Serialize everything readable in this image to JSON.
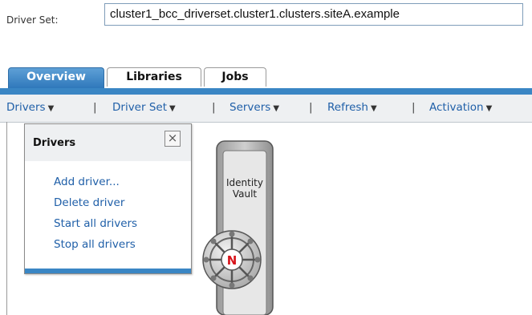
{
  "driver_set": {
    "label": "Driver Set:",
    "value": "cluster1_bcc_driverset.cluster1.clusters.siteA.example"
  },
  "tabs": [
    {
      "label": "Overview",
      "active": true
    },
    {
      "label": "Libraries",
      "active": false
    },
    {
      "label": "Jobs",
      "active": false
    }
  ],
  "menubar": {
    "items": [
      {
        "label": "Drivers"
      },
      {
        "label": "Driver Set"
      },
      {
        "label": "Servers"
      },
      {
        "label": "Refresh"
      },
      {
        "label": "Activation"
      }
    ],
    "separator": "|",
    "caret": "▼"
  },
  "drivers_menu": {
    "title": "Drivers",
    "close_glyph": "×",
    "items": [
      {
        "label": "Add driver..."
      },
      {
        "label": "Delete driver"
      },
      {
        "label": "Start all drivers"
      },
      {
        "label": "Stop all drivers"
      }
    ]
  },
  "vault": {
    "label_line1": "Identity",
    "label_line2": "Vault",
    "badge_letter": "N",
    "icon": "identity-vault-icon"
  },
  "colors": {
    "tab_active": "#3a86c4",
    "link": "#1f5fa8",
    "badge_red": "#d8141b"
  }
}
